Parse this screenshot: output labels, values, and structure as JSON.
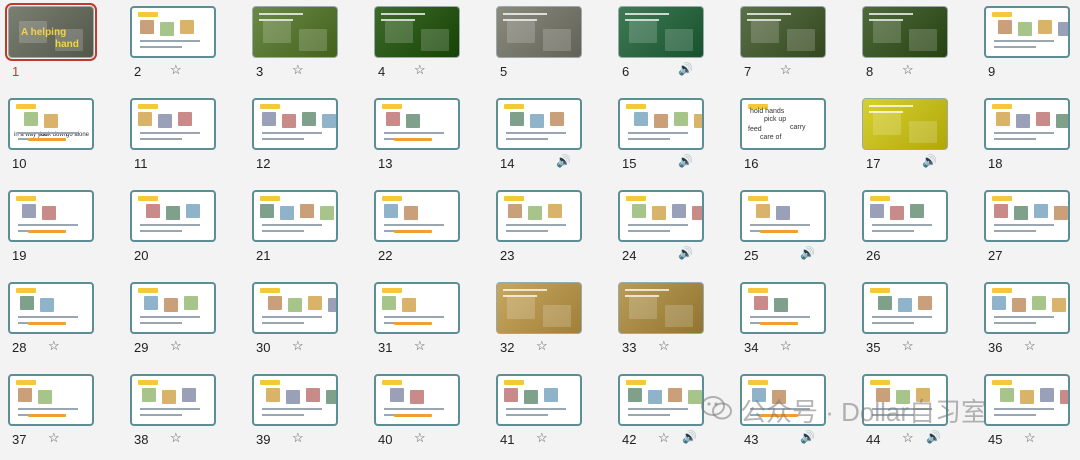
{
  "watermark": "公众号 · Dollar自习室",
  "slides": [
    {
      "n": "1",
      "type": "photo",
      "bg": "#7a7f72",
      "selected": true,
      "title_a": "A helping",
      "title_b": "hand",
      "star": false,
      "audio": false
    },
    {
      "n": "2",
      "type": "light",
      "star": true,
      "audio": false
    },
    {
      "n": "3",
      "type": "photo",
      "bg": "#6b8a45",
      "star": true,
      "audio": false
    },
    {
      "n": "4",
      "type": "photo",
      "bg": "#3e6b2c",
      "star": true,
      "audio": false
    },
    {
      "n": "5",
      "type": "photo",
      "bg": "#8a8a7e",
      "star": false,
      "audio": false
    },
    {
      "n": "6",
      "type": "photo",
      "bg": "#3f7a55",
      "star": false,
      "audio": true
    },
    {
      "n": "7",
      "type": "photo",
      "bg": "#5c7048",
      "star": true,
      "audio": false
    },
    {
      "n": "8",
      "type": "photo",
      "bg": "#4f6a3a",
      "star": true,
      "audio": false
    },
    {
      "n": "9",
      "type": "light",
      "star": false,
      "audio": false
    },
    {
      "n": "10",
      "type": "light",
      "star": false,
      "audio": false,
      "caps": [
        "in a way you",
        "look down",
        "go alone"
      ]
    },
    {
      "n": "11",
      "type": "light",
      "star": false,
      "audio": false
    },
    {
      "n": "12",
      "type": "light",
      "star": false,
      "audio": false
    },
    {
      "n": "13",
      "type": "light",
      "star": false,
      "audio": false
    },
    {
      "n": "14",
      "type": "light",
      "star": false,
      "audio": true
    },
    {
      "n": "15",
      "type": "light",
      "star": false,
      "audio": true
    },
    {
      "n": "16",
      "type": "light",
      "star": false,
      "audio": false,
      "words": [
        "hold hands",
        "pick up",
        "feed",
        "carry",
        "care of"
      ]
    },
    {
      "n": "17",
      "type": "photo",
      "bg": "#d8d030",
      "star": false,
      "audio": true
    },
    {
      "n": "18",
      "type": "light",
      "star": false,
      "audio": false
    },
    {
      "n": "19",
      "type": "light",
      "star": false,
      "audio": false
    },
    {
      "n": "20",
      "type": "light",
      "star": false,
      "audio": false
    },
    {
      "n": "21",
      "type": "light",
      "star": false,
      "audio": false
    },
    {
      "n": "22",
      "type": "light",
      "star": false,
      "audio": false
    },
    {
      "n": "23",
      "type": "light",
      "star": false,
      "audio": false
    },
    {
      "n": "24",
      "type": "light",
      "star": false,
      "audio": true
    },
    {
      "n": "25",
      "type": "light",
      "star": false,
      "audio": true
    },
    {
      "n": "26",
      "type": "light",
      "star": false,
      "audio": false
    },
    {
      "n": "27",
      "type": "light",
      "star": false,
      "audio": false
    },
    {
      "n": "28",
      "type": "light",
      "star": true,
      "audio": false
    },
    {
      "n": "29",
      "type": "light",
      "star": true,
      "audio": false
    },
    {
      "n": "30",
      "type": "light",
      "star": true,
      "audio": false
    },
    {
      "n": "31",
      "type": "light",
      "star": true,
      "audio": false
    },
    {
      "n": "32",
      "type": "photo",
      "bg": "#c8a860",
      "star": true,
      "audio": false
    },
    {
      "n": "33",
      "type": "photo",
      "bg": "#b89c58",
      "star": true,
      "audio": false
    },
    {
      "n": "34",
      "type": "light",
      "star": true,
      "audio": false
    },
    {
      "n": "35",
      "type": "light",
      "star": true,
      "audio": false
    },
    {
      "n": "36",
      "type": "light",
      "star": true,
      "audio": false
    },
    {
      "n": "37",
      "type": "light",
      "star": true,
      "audio": false
    },
    {
      "n": "38",
      "type": "light",
      "star": true,
      "audio": false
    },
    {
      "n": "39",
      "type": "light",
      "star": true,
      "audio": false
    },
    {
      "n": "40",
      "type": "light",
      "star": true,
      "audio": false
    },
    {
      "n": "41",
      "type": "light",
      "star": true,
      "audio": false
    },
    {
      "n": "42",
      "type": "light",
      "star": true,
      "audio": true
    },
    {
      "n": "43",
      "type": "light",
      "star": false,
      "audio": true
    },
    {
      "n": "44",
      "type": "light",
      "star": true,
      "audio": true
    },
    {
      "n": "45",
      "type": "light",
      "star": true,
      "audio": false
    }
  ],
  "icons": {
    "star": "☆",
    "audio": "🔊"
  }
}
